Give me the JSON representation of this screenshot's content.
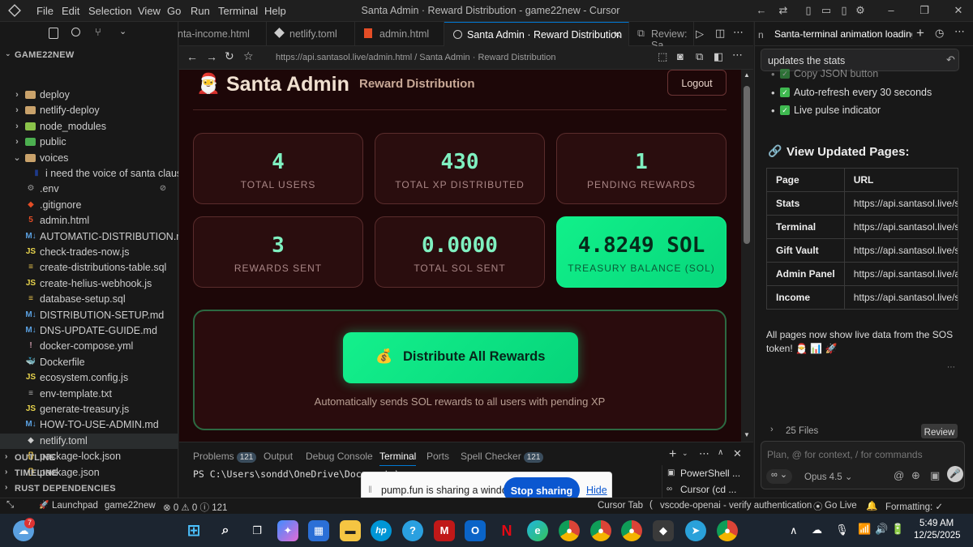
{
  "titlebar": {
    "menus": [
      "File",
      "Edit",
      "Selection",
      "View",
      "Go",
      "Run",
      "Terminal",
      "Help"
    ],
    "window_title": "Santa Admin · Reward Distribution - game22new - Cursor"
  },
  "sidebar": {
    "project": "GAME22NEW",
    "items": [
      {
        "label": "deploy",
        "type": "folder"
      },
      {
        "label": "netlify-deploy",
        "type": "folder"
      },
      {
        "label": "node_modules",
        "type": "folder"
      },
      {
        "label": "public",
        "type": "folder"
      },
      {
        "label": "voices",
        "type": "folder-open"
      },
      {
        "label": "i need the voice of santa claus ...",
        "type": "file"
      },
      {
        "label": ".env",
        "type": "file"
      },
      {
        "label": ".gitignore",
        "type": "file"
      },
      {
        "label": "admin.html",
        "type": "file"
      },
      {
        "label": "AUTOMATIC-DISTRIBUTION.md",
        "type": "file"
      },
      {
        "label": "check-trades-now.js",
        "type": "file"
      },
      {
        "label": "create-distributions-table.sql",
        "type": "file"
      },
      {
        "label": "create-helius-webhook.js",
        "type": "file"
      },
      {
        "label": "database-setup.sql",
        "type": "file"
      },
      {
        "label": "DISTRIBUTION-SETUP.md",
        "type": "file"
      },
      {
        "label": "DNS-UPDATE-GUIDE.md",
        "type": "file"
      },
      {
        "label": "docker-compose.yml",
        "type": "file"
      },
      {
        "label": "Dockerfile",
        "type": "file"
      },
      {
        "label": "ecosystem.config.js",
        "type": "file"
      },
      {
        "label": "env-template.txt",
        "type": "file"
      },
      {
        "label": "generate-treasury.js",
        "type": "file"
      },
      {
        "label": "HOW-TO-USE-ADMIN.md",
        "type": "file"
      },
      {
        "label": "netlify.toml",
        "type": "file"
      },
      {
        "label": "package-lock.json",
        "type": "file"
      },
      {
        "label": "package.json",
        "type": "file"
      }
    ],
    "sections": [
      "OUTLINE",
      "TIMELINE",
      "RUST DEPENDENCIES"
    ]
  },
  "tabs": [
    "nta-income.html",
    "netlify.toml",
    "admin.html",
    "Santa Admin · Reward Distribution",
    "Review: Sa"
  ],
  "address": {
    "url": "https://api.santasol.live/admin.html / Santa Admin · Reward Distribution"
  },
  "admin": {
    "brand": "Santa Admin",
    "subtitle": "Reward Distribution",
    "logout": "Logout",
    "cards": [
      {
        "value": "4",
        "label": "TOTAL USERS"
      },
      {
        "value": "430",
        "label": "TOTAL XP DISTRIBUTED"
      },
      {
        "value": "1",
        "label": "PENDING REWARDS"
      },
      {
        "value": "3",
        "label": "REWARDS SENT"
      },
      {
        "value": "0.0000",
        "label": "TOTAL SOL SENT"
      },
      {
        "value": "4.8249 SOL",
        "label": "TREASURY BALANCE (SOL)"
      }
    ],
    "distribute_button": "Distribute All Rewards",
    "distribute_note": "Automatically sends SOL rewards to all users with pending XP"
  },
  "panel": {
    "tabs": [
      {
        "label": "Problems",
        "badge": "121"
      },
      {
        "label": "Output"
      },
      {
        "label": "Debug Console"
      },
      {
        "label": "Terminal"
      },
      {
        "label": "Ports"
      },
      {
        "label": "Spell Checker",
        "badge": "121"
      }
    ],
    "terminal_line": "PS C:\\Users\\sondd\\OneDrive\\Documents\\game22new>",
    "terminals": [
      "PowerShell ...",
      "Cursor (cd ..."
    ]
  },
  "share": {
    "text": "pump.fun is sharing a window.",
    "stop": "Stop sharing",
    "hide": "Hide"
  },
  "chat": {
    "tab": "Santa-terminal animation loading",
    "query": "updates the stats",
    "bullets": [
      "Copy JSON button",
      "Auto-refresh every 30 seconds",
      "Live pulse indicator"
    ],
    "heading": "View Updated Pages:",
    "table_headers": [
      "Page",
      "URL"
    ],
    "rows": [
      {
        "page": "Stats",
        "url": "https://api.santasol.live/stats"
      },
      {
        "page": "Terminal",
        "url": "https://api.santasol.live/santa"
      },
      {
        "page": "Gift Vault",
        "url": "https://api.santasol.live/santa"
      },
      {
        "page": "Admin Panel",
        "url": "https://api.santasol.live/admin"
      },
      {
        "page": "Income",
        "url": "https://api.santasol.live/santa"
      }
    ],
    "summary": "All pages now show live data from the SOS token! 🎅 📊 🚀",
    "files": "25 Files",
    "review": "Review",
    "input_placeholder": "Plan, @ for context, / for commands",
    "mode": "∞",
    "model": "Opus 4.5"
  },
  "status": {
    "launchpad": "Launchpad",
    "workspace": "game22new",
    "problems": "⊗ 0 ⚠ 0 ⓘ 121",
    "cursor_tab": "Cursor Tab",
    "auth": "vscode-openai - verify authentication",
    "golive": "Go Live",
    "formatting": "Formatting: ✓"
  },
  "taskbar": {
    "time": "5:49 AM",
    "date": "12/25/2025",
    "badge_left": "7"
  }
}
